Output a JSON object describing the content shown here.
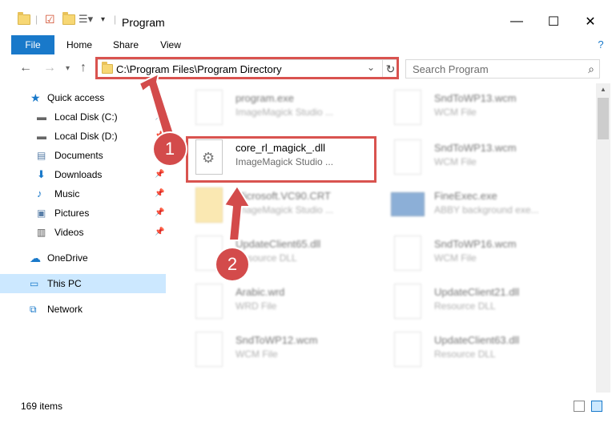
{
  "window": {
    "title": "Program",
    "minimize_glyph": "—",
    "maximize_glyph": "☐",
    "close_glyph": "✕"
  },
  "ribbon": {
    "tabs": [
      "File",
      "Home",
      "Share",
      "View"
    ]
  },
  "address_bar": {
    "path": "C:\\Program Files\\Program Directory",
    "search_placeholder": "Search Program"
  },
  "nav_pane": {
    "items": [
      {
        "label": "Quick access",
        "icon": "star-icon",
        "pinned": false
      },
      {
        "label": "Local Disk (C:)",
        "icon": "drive-icon",
        "pinned": true
      },
      {
        "label": "Local Disk (D:)",
        "icon": "drive-icon",
        "pinned": true
      },
      {
        "label": "Documents",
        "icon": "documents-icon",
        "pinned": true
      },
      {
        "label": "Downloads",
        "icon": "download-icon",
        "pinned": true
      },
      {
        "label": "Music",
        "icon": "music-icon",
        "pinned": true
      },
      {
        "label": "Pictures",
        "icon": "pictures-icon",
        "pinned": true
      },
      {
        "label": "Videos",
        "icon": "videos-icon",
        "pinned": true
      },
      {
        "label": "OneDrive",
        "icon": "cloud-icon",
        "pinned": false
      },
      {
        "label": "This PC",
        "icon": "computer-icon",
        "pinned": false,
        "selected": true
      },
      {
        "label": "Network",
        "icon": "network-icon",
        "pinned": false
      }
    ]
  },
  "files": [
    {
      "name": "program.exe",
      "type": "ImageMagick Studio ...",
      "blurred": true
    },
    {
      "name": "SndToWP13.wcm",
      "type": "WCM File",
      "blurred": true
    },
    {
      "name": "core_rl_magick_.dll",
      "type": "ImageMagick Studio ...",
      "blurred": false
    },
    {
      "name": "SndToWP13.wcm",
      "type": "WCM File",
      "blurred": true
    },
    {
      "name": "Microsoft.VC90.CRT",
      "type": "ImageMagick Studio ...",
      "blurred": true
    },
    {
      "name": "FineExec.exe",
      "type": "ABBY background exe...",
      "blurred": true
    },
    {
      "name": "UpdateClient65.dll",
      "type": "Resource DLL",
      "blurred": true
    },
    {
      "name": "SndToWP16.wcm",
      "type": "WCM File",
      "blurred": true
    },
    {
      "name": "Arabic.wrd",
      "type": "WRD File",
      "blurred": true
    },
    {
      "name": "UpdateClient21.dll",
      "type": "Resource DLL",
      "blurred": true
    },
    {
      "name": "SndToWP12.wcm",
      "type": "WCM File",
      "blurred": true
    },
    {
      "name": "UpdateClient63.dll",
      "type": "Resource DLL",
      "blurred": true
    }
  ],
  "status": {
    "item_count": "169 items"
  },
  "annotations": {
    "step1": "1",
    "step2": "2",
    "color": "#d34b4b"
  }
}
